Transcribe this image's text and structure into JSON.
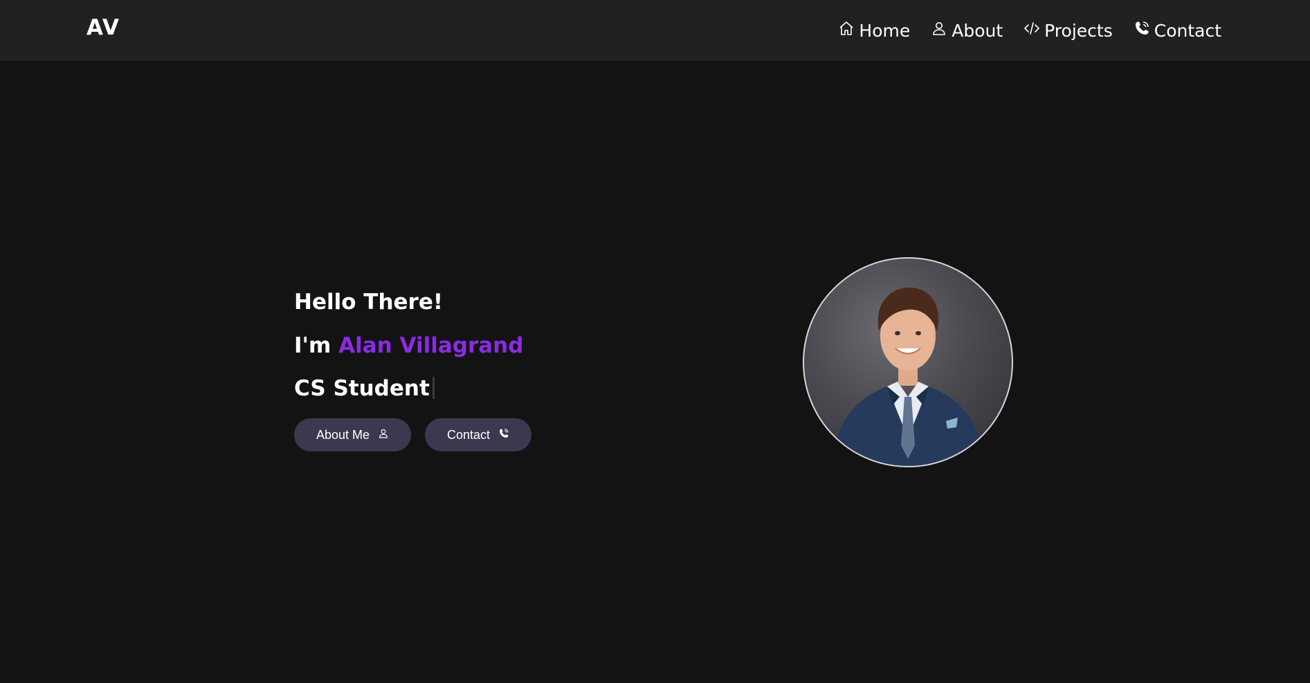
{
  "brand": {
    "logo": "AV"
  },
  "nav": {
    "items": [
      {
        "label": "Home",
        "icon": "home-icon"
      },
      {
        "label": "About",
        "icon": "user-icon"
      },
      {
        "label": "Projects",
        "icon": "code-icon"
      },
      {
        "label": "Contact",
        "icon": "phone-icon"
      }
    ]
  },
  "hero": {
    "greeting": "Hello There!",
    "intro_prefix": "I'm",
    "name": "Alan Villagrand",
    "role": "CS Student",
    "buttons": {
      "about_label": "About Me",
      "about_icon": "user-icon",
      "contact_label": "Contact",
      "contact_icon": "phone-icon"
    },
    "accent_color": "#8a2be2"
  },
  "profile_photo": {
    "icon": "profile-photo"
  }
}
